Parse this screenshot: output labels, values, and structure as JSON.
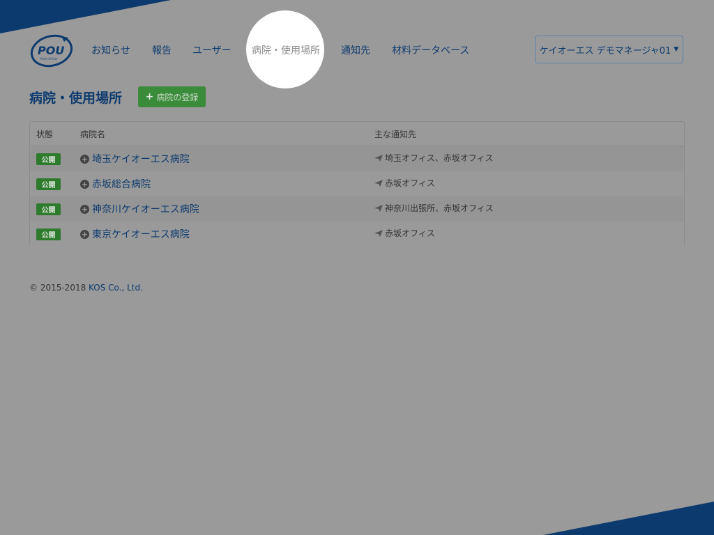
{
  "logo": {
    "text": "POU",
    "subtext": "Point Of Use"
  },
  "nav": {
    "items": [
      {
        "label": "お知らせ"
      },
      {
        "label": "報告"
      },
      {
        "label": "ユーザー"
      },
      {
        "label": "病院・使用場所"
      },
      {
        "label": "通知先"
      },
      {
        "label": "材料データベース"
      }
    ],
    "active_index": 3
  },
  "user_menu": {
    "label": "ケイオーエス デモマネージャ01"
  },
  "page": {
    "title": "病院・使用場所",
    "add_button": "病院の登録"
  },
  "table": {
    "headers": [
      "状態",
      "病院名",
      "主な通知先"
    ],
    "rows": [
      {
        "status": "公開",
        "name": "埼玉ケイオーエス病院",
        "notify": "埼玉オフィス、赤坂オフィス"
      },
      {
        "status": "公開",
        "name": "赤坂総合病院",
        "notify": "赤坂オフィス"
      },
      {
        "status": "公開",
        "name": "神奈川ケイオーエス病院",
        "notify": "神奈川出張所、赤坂オフィス"
      },
      {
        "status": "公開",
        "name": "東京ケイオーエス病院",
        "notify": "赤坂オフィス"
      }
    ]
  },
  "footer": {
    "copyright": "© 2015-2018 ",
    "company": "KOS Co., Ltd."
  },
  "colors": {
    "brand": "#0d3a6e",
    "success": "#3b8c3a",
    "overlay": "#9a9a9a"
  }
}
